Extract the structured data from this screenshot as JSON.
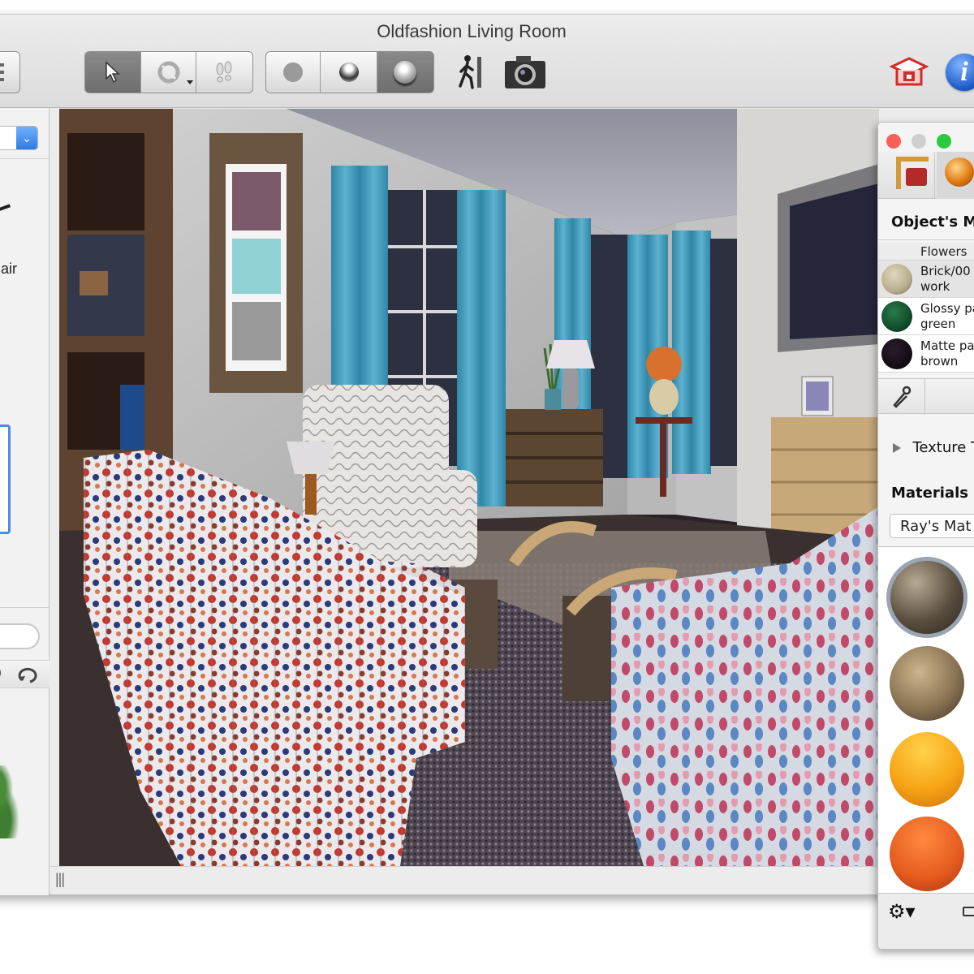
{
  "window": {
    "title": "Oldfashion Living Room"
  },
  "toolbar": {
    "sidebar_toggle_icon": "sidebar-list-icon",
    "mode_group": [
      {
        "name": "select-tool",
        "icon": "arrow-pointer-icon",
        "active": true
      },
      {
        "name": "orbit-tool",
        "icon": "orbit-rotate-icon",
        "active": false,
        "has_dropdown": true
      },
      {
        "name": "walk-tool",
        "icon": "footsteps-icon",
        "active": false
      }
    ],
    "render_group": [
      {
        "name": "render-flat",
        "icon": "flat-circle-icon",
        "active": false
      },
      {
        "name": "render-shaded",
        "icon": "shaded-sphere-icon",
        "active": false
      },
      {
        "name": "render-raytrace",
        "icon": "raytraced-sphere-icon",
        "active": true
      }
    ],
    "walkthrough_icon": "walking-person-icon",
    "camera_icon": "camera-icon",
    "export_icon": "export-box-icon",
    "info_icon": "info-icon",
    "info_glyph": "i"
  },
  "left_panel": {
    "partial_label": "air",
    "search_placeholder": "",
    "refresh_icon": "refresh-icon"
  },
  "viewport": {
    "scene": "3D rendered living room"
  },
  "statusbar": {
    "resize_handle": "|||"
  },
  "materials_panel": {
    "tabs": [
      {
        "name": "furniture-tab",
        "icon": "furniture-ruler-icon"
      },
      {
        "name": "materials-tab",
        "icon": "orange-sphere-icon"
      }
    ],
    "header": "Object's M",
    "list_header": "Flowers",
    "items": [
      {
        "label": "Brick/00\nwork",
        "color": "#b7ad8e"
      },
      {
        "label": "Glossy pa\ngreen",
        "color": "#0f4a28"
      },
      {
        "label": "Matte pa\nbrown",
        "color": "#120a12"
      }
    ],
    "eyedropper_icon": "eyedropper-icon",
    "texture_label": "Texture T",
    "collection_header": "Materials C",
    "collection_value": "Ray's Mat",
    "swatches": [
      {
        "name": "floral-fabric",
        "color": "#5a4e3f",
        "selected": true
      },
      {
        "name": "snake-leather",
        "color": "#8a7454",
        "selected": false
      },
      {
        "name": "glossy-orange",
        "color": "#f7a516",
        "selected": false
      },
      {
        "name": "matte-red-orange",
        "color": "#e45a1e",
        "selected": false
      }
    ],
    "gear_icon": "gear-icon",
    "footer_icon": "preview-icon"
  },
  "colors": {
    "accent_blue": "#3b82e0",
    "close_red": "#fc5f57",
    "zoom_green": "#2ac940",
    "minimize_gray": "#cfcfcf",
    "curtain_blue": "#3d97b6"
  }
}
